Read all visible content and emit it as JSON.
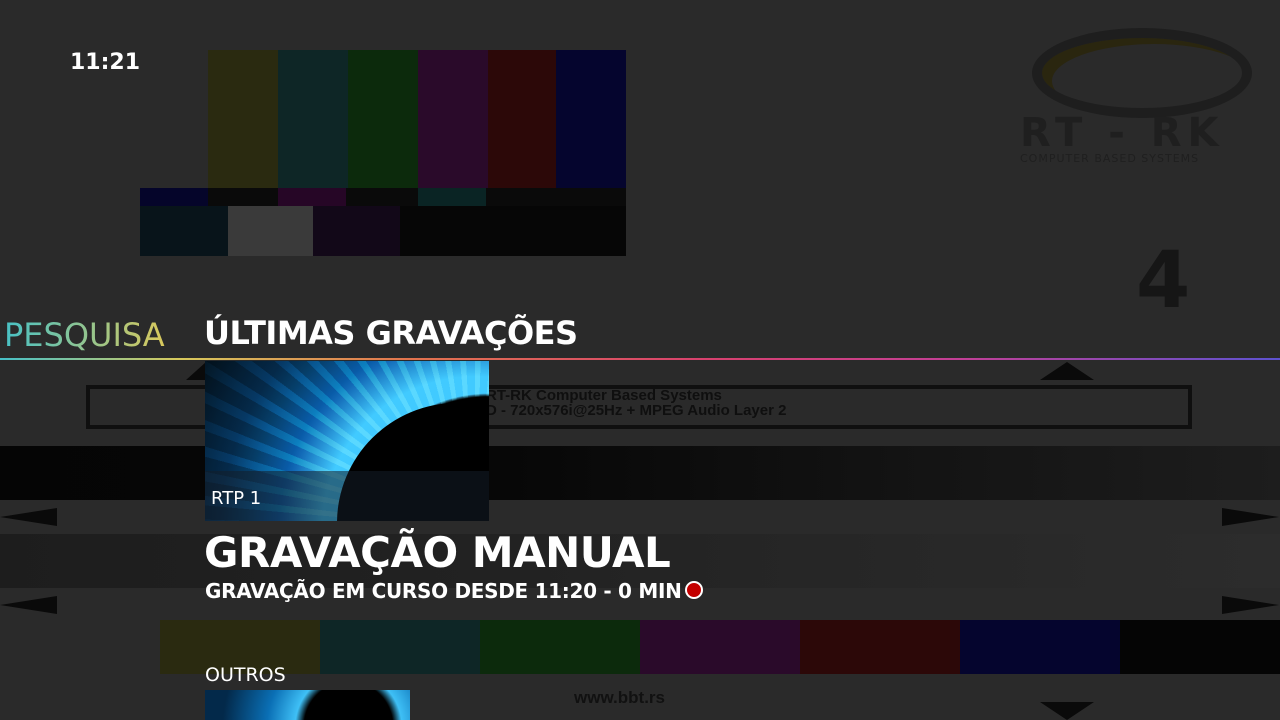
{
  "clock": {
    "time": "11:21"
  },
  "nav": {
    "search_label": "PESQUISA",
    "recent_label": "ÚLTIMAS GRAVAÇÕES"
  },
  "recording": {
    "channel": "RTP 1",
    "title": "GRAVAÇÃO MANUAL",
    "status": "GRAVAÇÃO EM CURSO DESDE 11:20 - 0 MIN",
    "status_indicator": "recording-dot-icon"
  },
  "sections": {
    "other_label": "OUTROS"
  },
  "background": {
    "logo_text": "RT - RK",
    "logo_subtitle": "COMPUTER BASED SYSTEMS",
    "channel_number": "4",
    "info_line_1": "RT-RK Computer Based Systems",
    "info_line_2": "D - 720x576i@25Hz + MPEG Audio Layer 2",
    "url": "www.bbt.rs"
  },
  "colors": {
    "accent_gradient": [
      "#46c0c8",
      "#d7c95c",
      "#e2744e",
      "#d8416e",
      "#c23f96",
      "#5d52d0"
    ],
    "recording": "#c40000"
  }
}
